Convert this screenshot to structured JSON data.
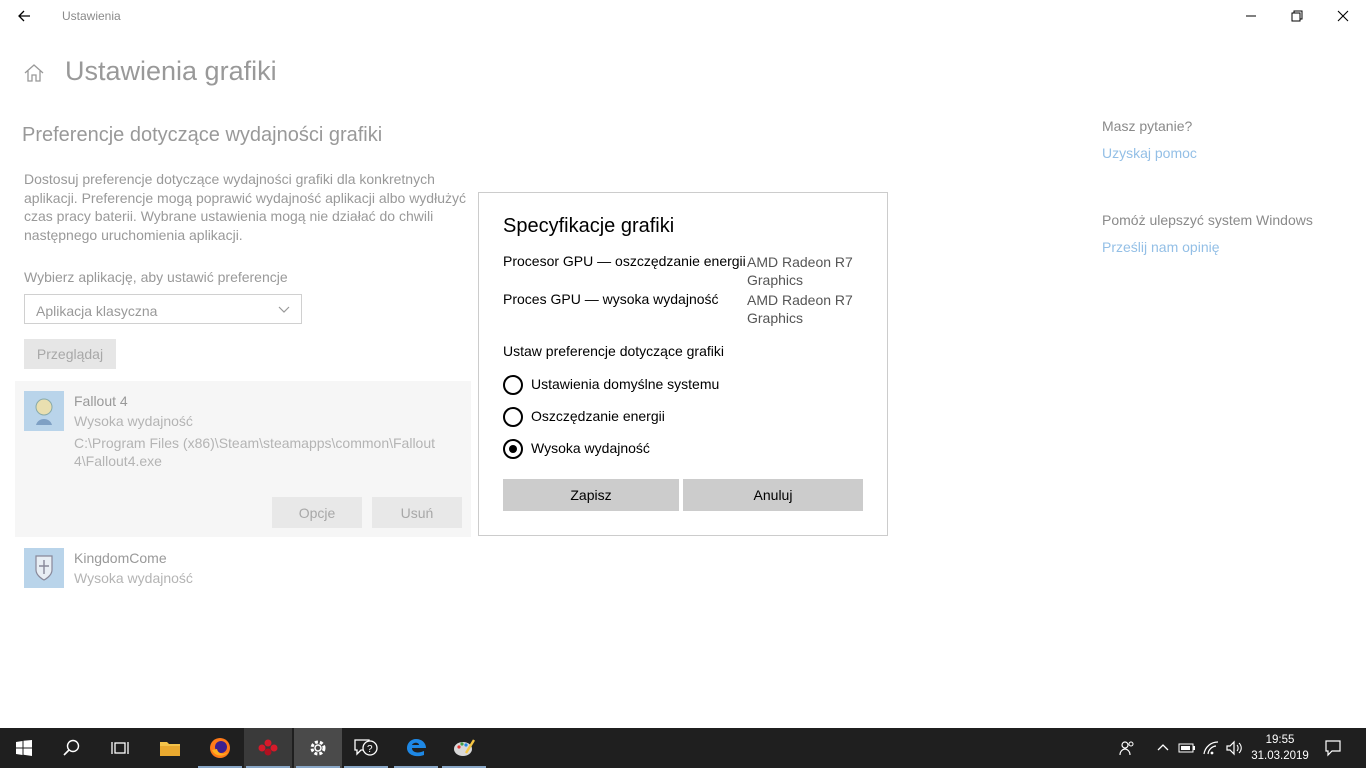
{
  "window": {
    "title": "Ustawienia",
    "back_icon": "back-arrow-icon",
    "minimize_icon": "minimize-icon",
    "restore_icon": "restore-icon",
    "close_icon": "close-icon"
  },
  "page": {
    "title": "Ustawienia grafiki",
    "section_title": "Preferencje dotyczące wydajności grafiki",
    "description": "Dostosuj preferencje dotyczące wydajności grafiki dla konkretnych aplikacji. Preferencje mogą poprawić wydajność aplikacji albo wydłużyć czas pracy baterii. Wybrane ustawienia mogą nie działać do chwili następnego uruchomienia aplikacji.",
    "choose_label": "Wybierz aplikację, aby ustawić preferencje",
    "dropdown_value": "Aplikacja klasyczna",
    "browse_label": "Przeglądaj"
  },
  "apps": [
    {
      "name": "Fallout 4",
      "mode": "Wysoka wydajność",
      "path": "C:\\Program Files (x86)\\Steam\\steamapps\\common\\Fallout 4\\Fallout4.exe",
      "options_label": "Opcje",
      "remove_label": "Usuń"
    },
    {
      "name": "KingdomCome",
      "mode": "Wysoka wydajność"
    }
  ],
  "help": {
    "question": "Masz pytanie?",
    "get_help": "Uzyskaj pomoc",
    "improve": "Pomóż ulepszyć system Windows",
    "feedback": "Prześlij nam opinię",
    "link_color": "#93bfe6"
  },
  "dialog": {
    "title": "Specyfikacje grafiki",
    "rows": [
      {
        "label": "Procesor GPU — oszczędzanie energii",
        "value": "AMD Radeon R7 Graphics"
      },
      {
        "label": "Proces GPU — wysoka wydajność",
        "value": "AMD Radeon R7 Graphics"
      }
    ],
    "pref_label": "Ustaw preferencje dotyczące grafiki",
    "options": [
      {
        "label": "Ustawienia domyślne systemu",
        "checked": false
      },
      {
        "label": "Oszczędzanie energii",
        "checked": false
      },
      {
        "label": "Wysoka wydajność",
        "checked": true
      }
    ],
    "save_label": "Zapisz",
    "cancel_label": "Anuluj"
  },
  "taskbar": {
    "items": [
      "windows-start-icon",
      "search-icon",
      "task-view-icon",
      "file-explorer-icon",
      "firefox-icon",
      "app-red-icon",
      "settings-gear-icon",
      "feedback-hub-icon",
      "edge-icon",
      "paint-icon"
    ],
    "tray": [
      "people-icon",
      "chevron-up-icon",
      "battery-icon",
      "wifi-icon",
      "volume-icon"
    ],
    "time": "19:55",
    "date": "31.03.2019",
    "notification_icon": "action-center-icon"
  }
}
